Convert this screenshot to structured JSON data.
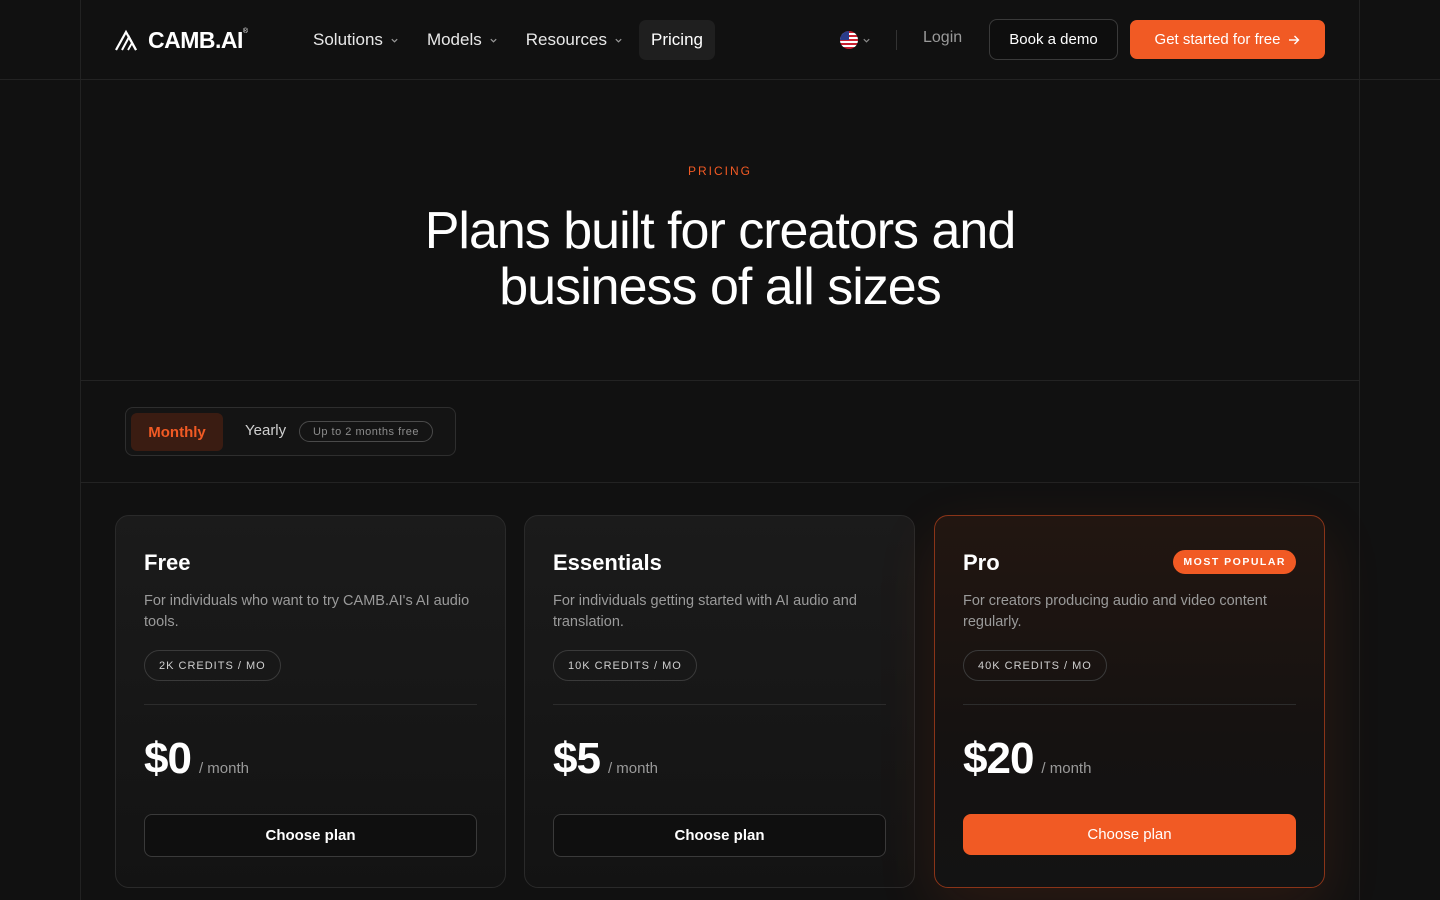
{
  "nav": {
    "logo_text": "CAMB.AI",
    "logo_reg": "®",
    "menu": [
      {
        "label": "Solutions"
      },
      {
        "label": "Models"
      },
      {
        "label": "Resources"
      },
      {
        "label": "Pricing"
      }
    ],
    "login_label": "Login",
    "demo_label": "Book a demo",
    "start_label": "Get started for free",
    "icons": {
      "flag": "us-flag-icon",
      "chevron": "chevron-down-icon",
      "arrow": "arrow-right-icon"
    }
  },
  "hero": {
    "eyebrow": "PRICING",
    "title_line1": "Plans built for creators and",
    "title_line2": "business of all sizes"
  },
  "billing": {
    "monthly_label": "Monthly",
    "yearly_label": "Yearly",
    "yearly_badge": "Up to 2 months free",
    "selected": "Monthly"
  },
  "plans": [
    {
      "name": "Free",
      "description": "For individuals who want to try CAMB.AI's AI audio tools.",
      "credits": "2K CREDITS / MO",
      "price": "$0",
      "unit": "/ month",
      "cta": "Choose plan"
    },
    {
      "name": "Essentials",
      "description": "For individuals getting started with AI audio and translation.",
      "credits": "10K CREDITS / MO",
      "price": "$5",
      "unit": "/ month",
      "cta": "Choose plan"
    },
    {
      "name": "Pro",
      "badge": "MOST POPULAR",
      "description": "For creators producing audio and video content regularly.",
      "credits": "40K CREDITS / MO",
      "price": "$20",
      "unit": "/ month",
      "cta": "Choose plan"
    }
  ],
  "colors": {
    "accent": "#f15a24",
    "background": "#111111",
    "card": "#1b1b1b"
  }
}
